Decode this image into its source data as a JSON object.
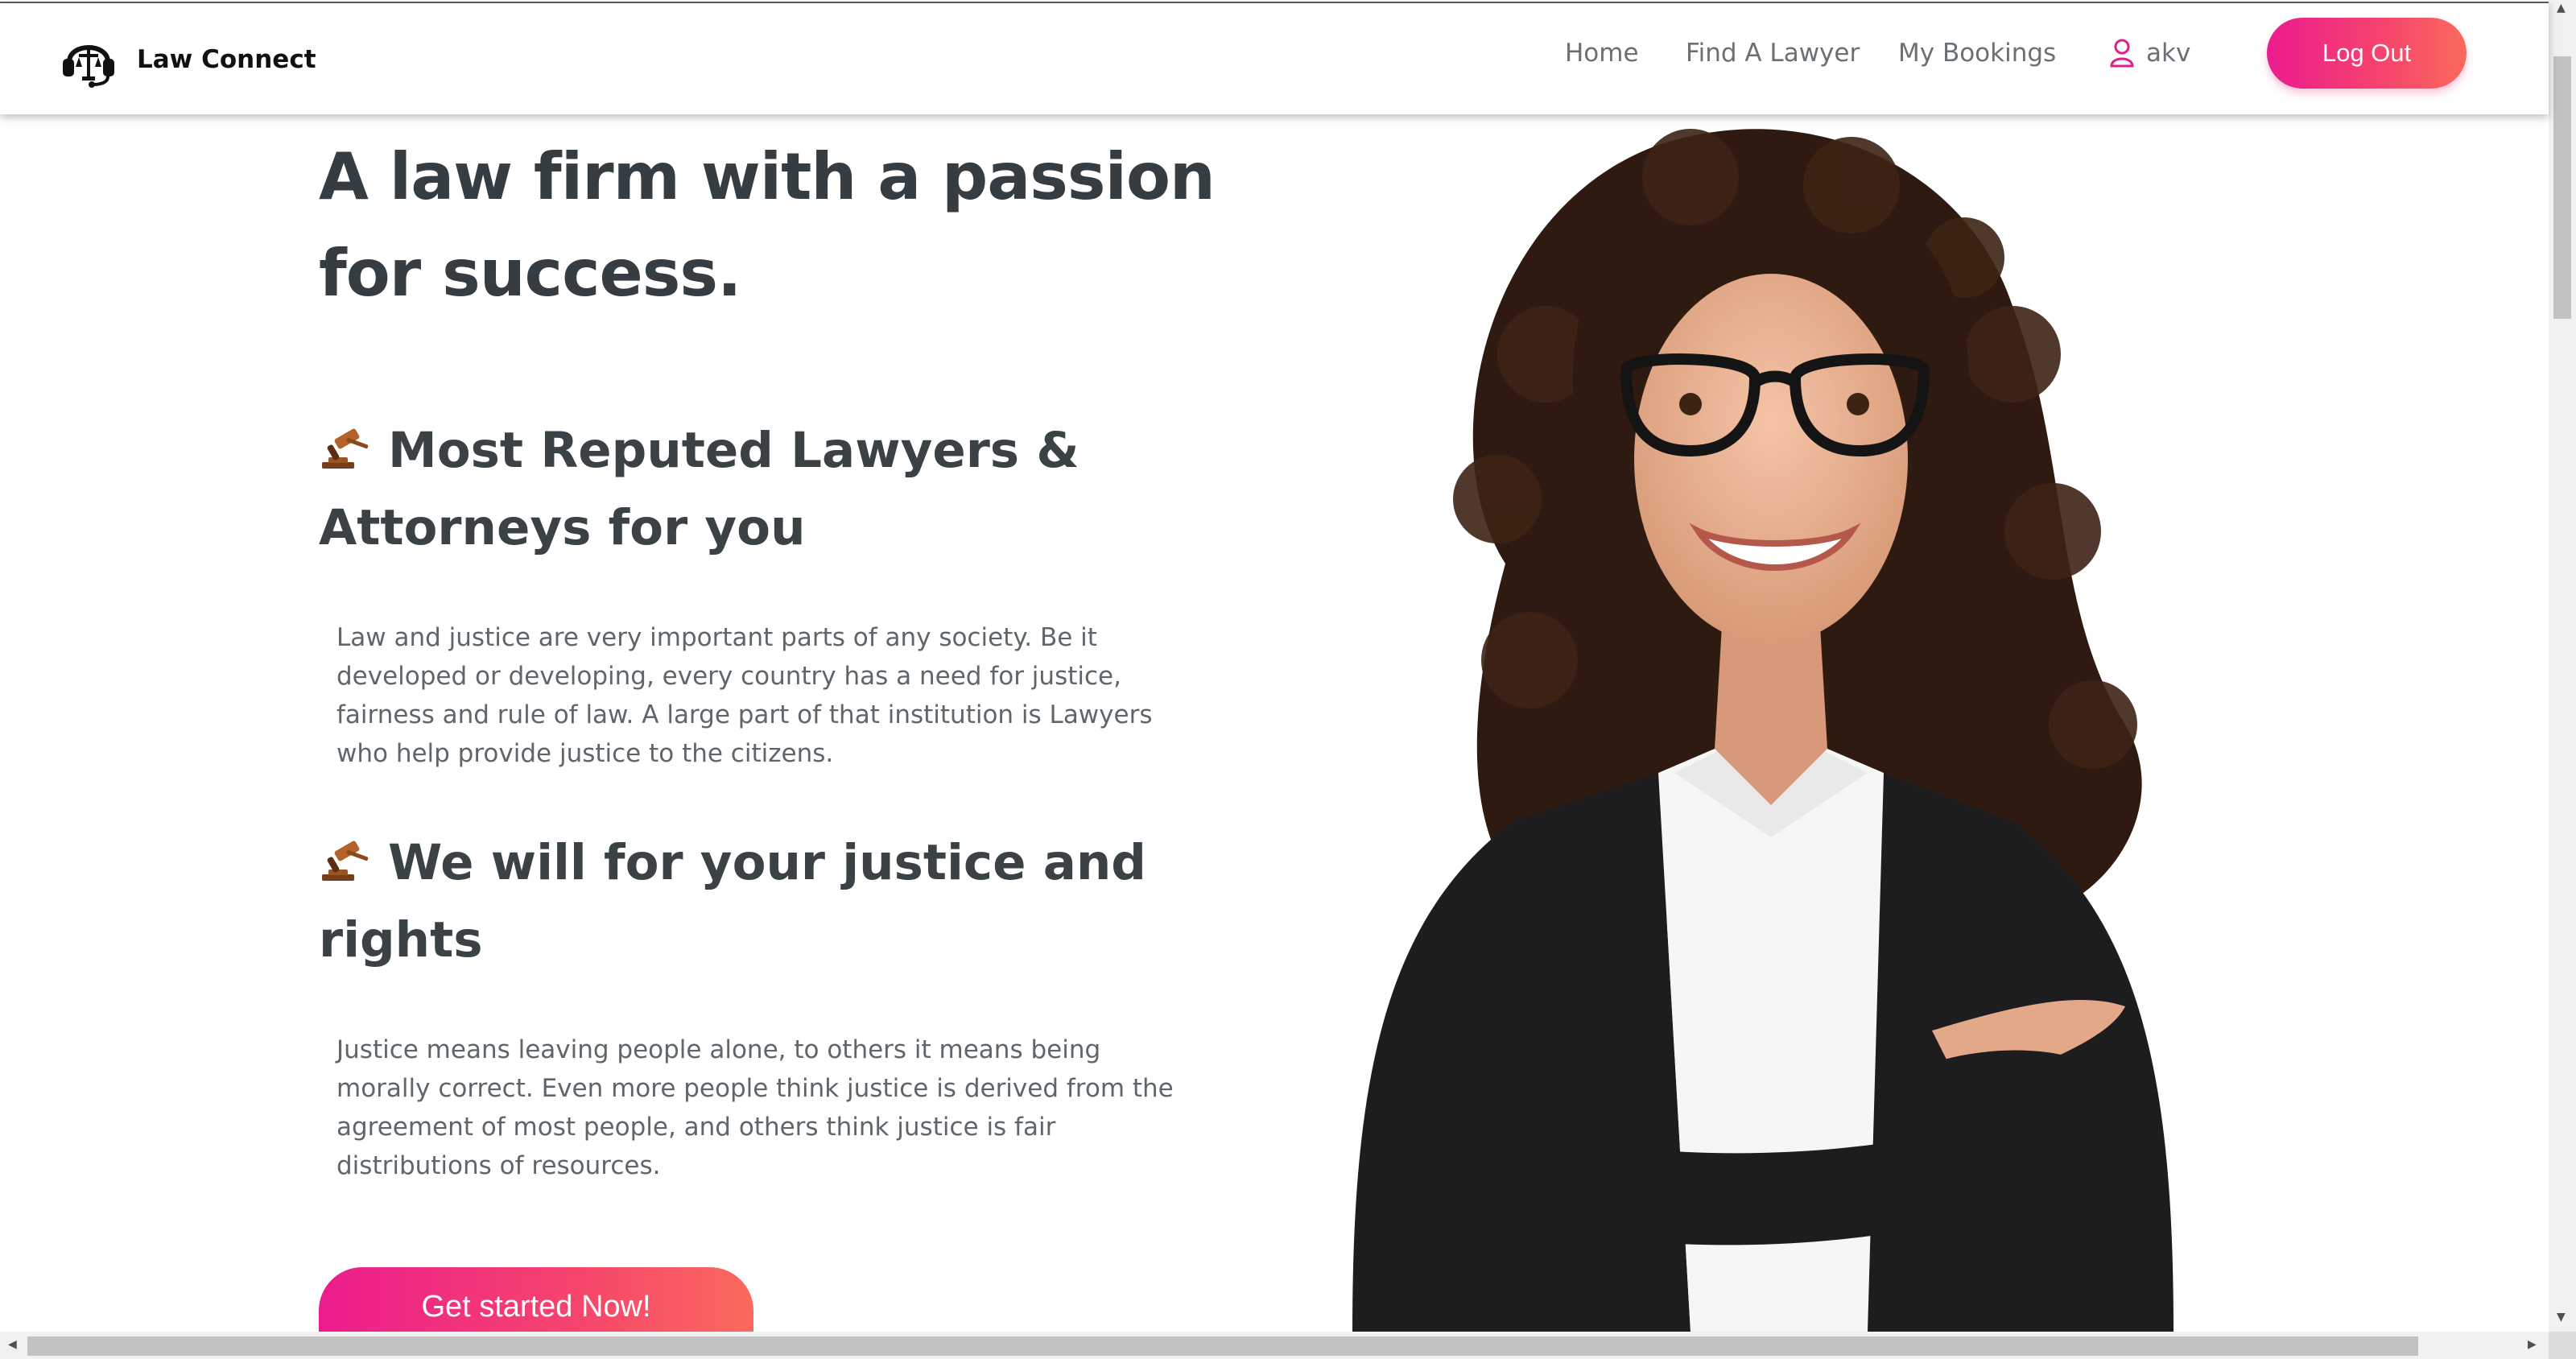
{
  "brand": {
    "name": "Law Connect",
    "logo_icon": "headset-scales-icon"
  },
  "nav": {
    "links": [
      "Home",
      "Find A Lawyer",
      "My Bookings"
    ],
    "user": {
      "name": "akv",
      "icon": "user-icon"
    },
    "logout_label": "Log Out"
  },
  "hero": {
    "title_line1": "A law firm with a passion",
    "title_line2": "for success.",
    "features": [
      {
        "icon": "gavel-icon",
        "title_line1": "Most Reputed Lawyers &",
        "title_line2": "Attorneys for you",
        "text": [
          "Law and justice are very important parts of any society. Be it",
          "developed or developing, every country has a need for justice,",
          "fairness and rule of law. A large part of that institution is Lawyers",
          "who help provide justice to the citizens."
        ]
      },
      {
        "icon": "gavel-icon",
        "title_line1": "We will for your justice and",
        "title_line2": "rights",
        "text": [
          "Justice means leaving people alone, to others it means being",
          "morally correct. Even more people think justice is derived from the",
          "agreement of most people, and others think justice is fair",
          "distributions of resources."
        ]
      }
    ],
    "cta_label": "Get started Now!"
  },
  "colors": {
    "accent_start": "#ec1c8e",
    "accent_end": "#fa6a5c",
    "heading": "#363d42",
    "body_text": "#5f666b"
  }
}
